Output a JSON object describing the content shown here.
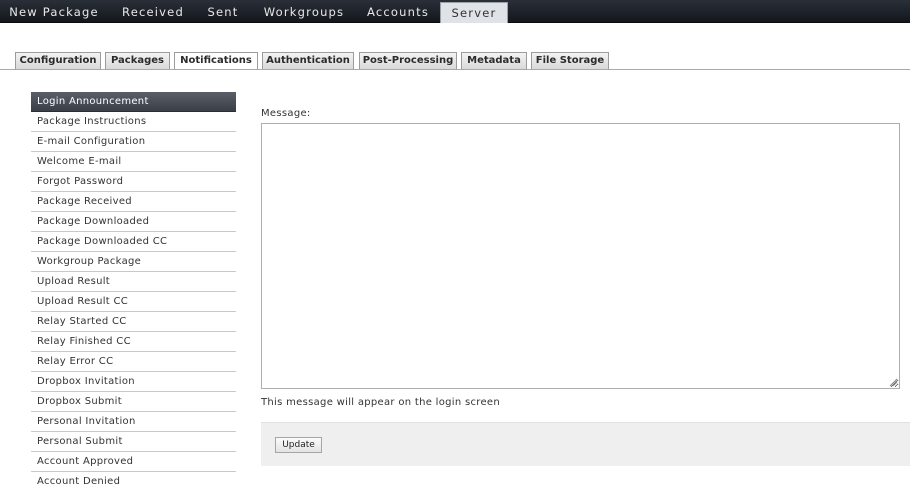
{
  "topnav": {
    "items": [
      {
        "label": "New Package"
      },
      {
        "label": "Received"
      },
      {
        "label": "Sent"
      },
      {
        "label": "Workgroups"
      },
      {
        "label": "Accounts"
      },
      {
        "label": "Server",
        "active": true
      }
    ]
  },
  "tabs": [
    {
      "label": "Configuration"
    },
    {
      "label": "Packages"
    },
    {
      "label": "Notifications",
      "active": true
    },
    {
      "label": "Authentication"
    },
    {
      "label": "Post-Processing"
    },
    {
      "label": "Metadata"
    },
    {
      "label": "File Storage"
    }
  ],
  "sidebar": {
    "items": [
      {
        "label": "Login Announcement",
        "active": true
      },
      {
        "label": "Package Instructions"
      },
      {
        "label": "E-mail Configuration"
      },
      {
        "label": "Welcome E-mail"
      },
      {
        "label": "Forgot Password"
      },
      {
        "label": "Package Received"
      },
      {
        "label": "Package Downloaded"
      },
      {
        "label": "Package Downloaded CC"
      },
      {
        "label": "Workgroup Package"
      },
      {
        "label": "Upload Result"
      },
      {
        "label": "Upload Result CC"
      },
      {
        "label": "Relay Started CC"
      },
      {
        "label": "Relay Finished CC"
      },
      {
        "label": "Relay Error CC"
      },
      {
        "label": "Dropbox Invitation"
      },
      {
        "label": "Dropbox Submit"
      },
      {
        "label": "Personal Invitation"
      },
      {
        "label": "Personal Submit"
      },
      {
        "label": "Account Approved"
      },
      {
        "label": "Account Denied"
      }
    ]
  },
  "main": {
    "message_label": "Message:",
    "message_value": "",
    "hint": "This message will appear on the login screen",
    "update_label": "Update"
  },
  "colors": {
    "nav_bg": "#1b1f26",
    "active_sidebar": "#474b53"
  }
}
